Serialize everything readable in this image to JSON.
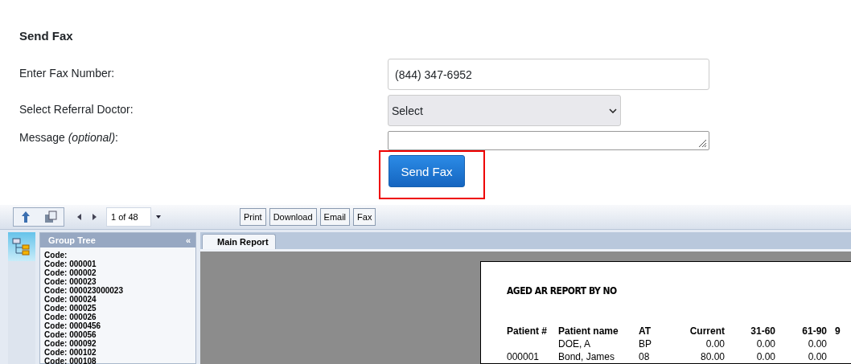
{
  "form": {
    "title": "Send Fax",
    "fields": [
      {
        "kind": "text",
        "label": "Enter Fax Number:",
        "value": "(844) 347-6952"
      },
      {
        "kind": "select",
        "label": "Select Referral Doctor:",
        "value": "Select"
      },
      {
        "kind": "textarea",
        "label": "Message *(optional)*:"
      }
    ],
    "submit": {
      "label": "Send Fax",
      "highlighted": true
    }
  },
  "viewer": {
    "toolbar": {
      "page_field": "1 of 48",
      "buttons": [
        "Print",
        "Download",
        "Email",
        "Fax"
      ]
    },
    "group_tree": {
      "title": "Group Tree",
      "collapse": "«",
      "items": [
        "Code:",
        "Code: 000001",
        "Code: 000002",
        "Code: 000023",
        "Code: 000023000023",
        "Code: 000024",
        "Code: 000025",
        "Code: 000026",
        "Code: 0000456",
        "Code: 000056",
        "Code: 000092",
        "Code: 000102",
        "Code: 000108"
      ]
    },
    "tabs": [
      {
        "label": "Main Report",
        "selected": true
      }
    ],
    "report": {
      "title": "AGED AR REPORT BY NO",
      "columns": [
        "Patient #",
        "Patient name",
        "AT",
        "Current",
        "31-60",
        "61-90",
        "9"
      ],
      "rows": [
        [
          null,
          "DOE, A",
          "BP",
          "0.00",
          "0.00",
          "0.00"
        ],
        [
          "000001",
          "Bond, James",
          "08",
          "80.00",
          "0.00",
          "0.00"
        ]
      ]
    }
  }
}
